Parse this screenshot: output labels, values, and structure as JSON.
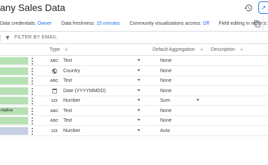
{
  "header": {
    "title": "any Sales Data",
    "history_icon": "history-icon",
    "share_icon": "share-icon"
  },
  "settings": {
    "data_credentials_label": "Data credentials:",
    "data_credentials_value": "Owner",
    "data_freshness_label": "Data freshness:",
    "data_freshness_value": "15 minutes",
    "community_viz_label": "Community visualizations access:",
    "community_viz_value": "Off",
    "field_editing_label": "Field editing in reports:",
    "field_editing_value": "On",
    "copy_icon": "copy-icon"
  },
  "filter": {
    "label": "FILTER BY EMAIL",
    "icon": "filter-icon"
  },
  "columns": {
    "type": "Type",
    "default_aggregation": "Default Aggregation",
    "description": "Description"
  },
  "rows": [
    {
      "name": "",
      "type_icon": "ABC",
      "type": "Text",
      "aggregation": "None",
      "agg_dropdown": false,
      "name_color": "green"
    },
    {
      "name": "",
      "type_icon": "globe",
      "type": "Country",
      "aggregation": "None",
      "agg_dropdown": false,
      "name_color": "green"
    },
    {
      "name": "",
      "type_icon": "ABC",
      "type": "Text",
      "aggregation": "None",
      "agg_dropdown": false,
      "name_color": "green"
    },
    {
      "name": "",
      "type_icon": "calendar",
      "type": "Date (YYYYMMDD)",
      "aggregation": "None",
      "agg_dropdown": false,
      "name_color": "green"
    },
    {
      "name": "",
      "type_icon": "123",
      "type": "Number",
      "aggregation": "Sum",
      "agg_dropdown": true,
      "name_color": "green"
    },
    {
      "name": "ntative",
      "type_icon": "ABC",
      "type": "Text",
      "aggregation": "None",
      "agg_dropdown": false,
      "name_color": "green"
    },
    {
      "name": "",
      "type_icon": "ABC",
      "type": "Text",
      "aggregation": "None",
      "agg_dropdown": false,
      "name_color": "green"
    },
    {
      "name": "",
      "type_icon": "123",
      "type": "Number",
      "aggregation": "Auto",
      "agg_dropdown": false,
      "name_color": "blue"
    }
  ],
  "colors": {
    "accent": "#1a73e8",
    "dimension_green": "#b7e1b4",
    "metric_blue": "#c5cfe3"
  }
}
